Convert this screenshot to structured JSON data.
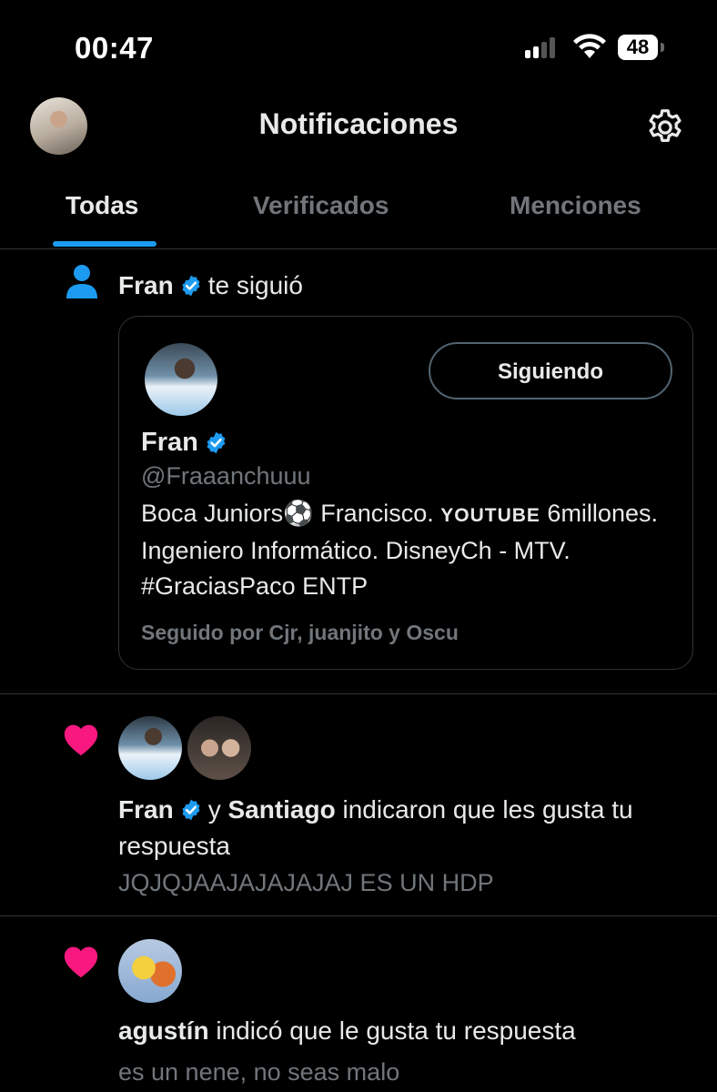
{
  "status_bar": {
    "time": "00:47",
    "battery": "48"
  },
  "header": {
    "title": "Notificaciones"
  },
  "tabs": [
    {
      "label": "Todas",
      "active": true
    },
    {
      "label": "Verificados",
      "active": false
    },
    {
      "label": "Menciones",
      "active": false
    }
  ],
  "colors": {
    "accent": "#1d9bf0",
    "like": "#f91880",
    "muted": "#71767b"
  },
  "notifications": [
    {
      "type": "follow",
      "icon": "person-icon",
      "actor": "Fran",
      "action": "te siguió",
      "card": {
        "name": "Fran",
        "handle": "@Fraaanchuuu",
        "bio_part1": "Boca Juniors⚽ Francisco. ",
        "bio_youtube": "YOUTUBE",
        "bio_part2": " 6millones. Ingeniero Informático. DisneyCh - MTV. #GraciasPaco ENTP",
        "followed_by": "Seguido por Cjr, juanjito y Oscu",
        "button": "Siguiendo"
      }
    },
    {
      "type": "like",
      "icon": "heart-icon",
      "actor1": "Fran",
      "conj": "y",
      "actor2": "Santiago",
      "action": "indicaron que les gusta tu respuesta",
      "quote": "JQJQJAAJAJAJAJAJ ES UN HDP"
    },
    {
      "type": "like",
      "icon": "heart-icon",
      "actor": "agustín",
      "action": "indicó que le gusta tu respuesta",
      "quote": "es un nene, no seas malo"
    }
  ]
}
